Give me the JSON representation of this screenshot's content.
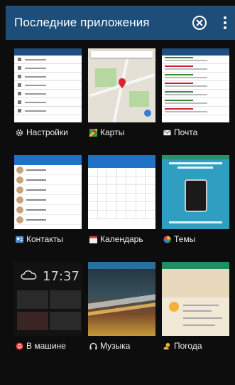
{
  "header": {
    "title": "Последние приложения",
    "background": "#1d4e79"
  },
  "apps": [
    {
      "label": "Настройки",
      "icon": "gear-icon"
    },
    {
      "label": "Карты",
      "icon": "maps-icon"
    },
    {
      "label": "Почта",
      "icon": "mail-icon"
    },
    {
      "label": "Контакты",
      "icon": "contacts-icon"
    },
    {
      "label": "Календарь",
      "icon": "calendar-icon"
    },
    {
      "label": "Темы",
      "icon": "themes-icon"
    },
    {
      "label": "В машине",
      "icon": "car-icon"
    },
    {
      "label": "Музыка",
      "icon": "headphones-icon"
    },
    {
      "label": "Погода",
      "icon": "weather-icon"
    }
  ],
  "thumbnails": {
    "car_clock": "17:37"
  }
}
